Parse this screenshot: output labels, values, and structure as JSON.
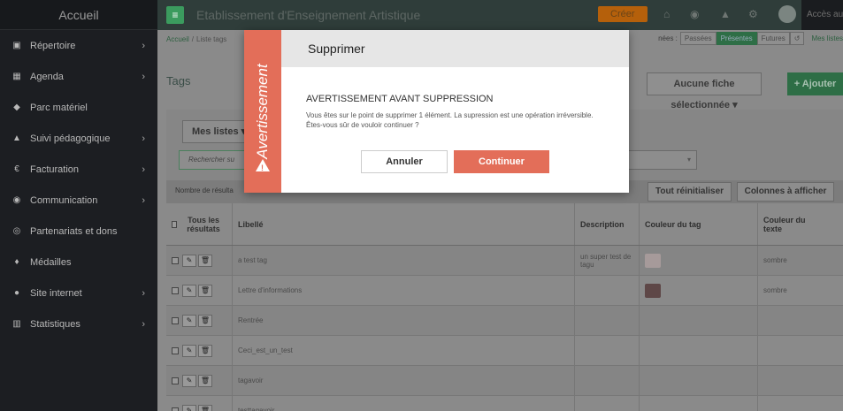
{
  "sidebar": {
    "title": "Accueil",
    "items": [
      {
        "label": "Répertoire",
        "icon": "address-book-icon",
        "glyph": "▣",
        "chevron": "›"
      },
      {
        "label": "Agenda",
        "icon": "calendar-icon",
        "glyph": "▦",
        "chevron": "›"
      },
      {
        "label": "Parc matériel",
        "icon": "tools-icon",
        "glyph": "◆",
        "chevron": ""
      },
      {
        "label": "Suivi pédagogique",
        "icon": "graduation-cap-icon",
        "glyph": "▲",
        "chevron": "›"
      },
      {
        "label": "Facturation",
        "icon": "euro-icon",
        "glyph": "€",
        "chevron": "›"
      },
      {
        "label": "Communication",
        "icon": "comments-icon",
        "glyph": "◉",
        "chevron": "›"
      },
      {
        "label": "Partenariats et dons",
        "icon": "handshake-icon",
        "glyph": "◎",
        "chevron": ""
      },
      {
        "label": "Médailles",
        "icon": "trophy-icon",
        "glyph": "♦",
        "chevron": ""
      },
      {
        "label": "Site internet",
        "icon": "globe-icon",
        "glyph": "●",
        "chevron": "›"
      },
      {
        "label": "Statistiques",
        "icon": "bar-chart-icon",
        "glyph": "▥",
        "chevron": "›"
      }
    ]
  },
  "topbar": {
    "menu_glyph": "≡",
    "app_title": "Etablissement d'Enseignement Artistique",
    "create_label": "Créer",
    "home_glyph": "⌂",
    "globe_glyph": "◉",
    "bell_glyph": "▲",
    "gear_glyph": "⚙",
    "access_label": "Accès au"
  },
  "breadcrumb": {
    "home": "Accueil",
    "sep": "/",
    "current": "Liste tags"
  },
  "filters": {
    "label": "nées :",
    "passed": "Passées",
    "present": "Présentes",
    "future": "Futures",
    "reset_glyph": "↺",
    "my_lists": "Mes listes"
  },
  "page": {
    "title": "Tags",
    "no_selection": "Aucune fiche sélectionnée ▾",
    "add_label": "+ Ajouter"
  },
  "panel": {
    "my_lists_btn": "Mes listes ▾",
    "search_placeholder": "Rechercher su",
    "select_chevron": "▾",
    "results_label": "Nombre de résulta",
    "reset_all": "Tout réinitialiser",
    "columns_btn": "Colonnes à afficher"
  },
  "table": {
    "headers": {
      "all": "Tous les résultats",
      "label": "Libellé",
      "description": "Description",
      "tag_color": "Couleur du tag",
      "text_color": "Couleur du texte"
    },
    "edit_glyph": "✎",
    "delete_glyph": "🗑",
    "rows": [
      {
        "label": "a test tag",
        "description": "un super test de tagu",
        "color": "#a69a9a",
        "text_color": "sombre"
      },
      {
        "label": "Lettre d'informations",
        "description": "",
        "color": "#5e4747",
        "text_color": "sombre"
      },
      {
        "label": "Rentrée",
        "description": "",
        "color": "",
        "text_color": ""
      },
      {
        "label": "Ceci_est_un_test",
        "description": "",
        "color": "",
        "text_color": ""
      },
      {
        "label": "tagavoir",
        "description": "",
        "color": "",
        "text_color": ""
      },
      {
        "label": "testtagavoir",
        "description": "",
        "color": "",
        "text_color": ""
      }
    ]
  },
  "modal": {
    "side_label": "Avertissement",
    "warn_glyph": "!",
    "title": "Supprimer",
    "warning_title": "AVERTISSEMENT AVANT SUPPRESSION",
    "message": "Vous êtes sur le point de supprimer 1 élément. La supression est une opération irréversible. Êtes-vous sûr de vouloir continuer ?",
    "cancel_label": "Annuler",
    "continue_label": "Continuer"
  }
}
